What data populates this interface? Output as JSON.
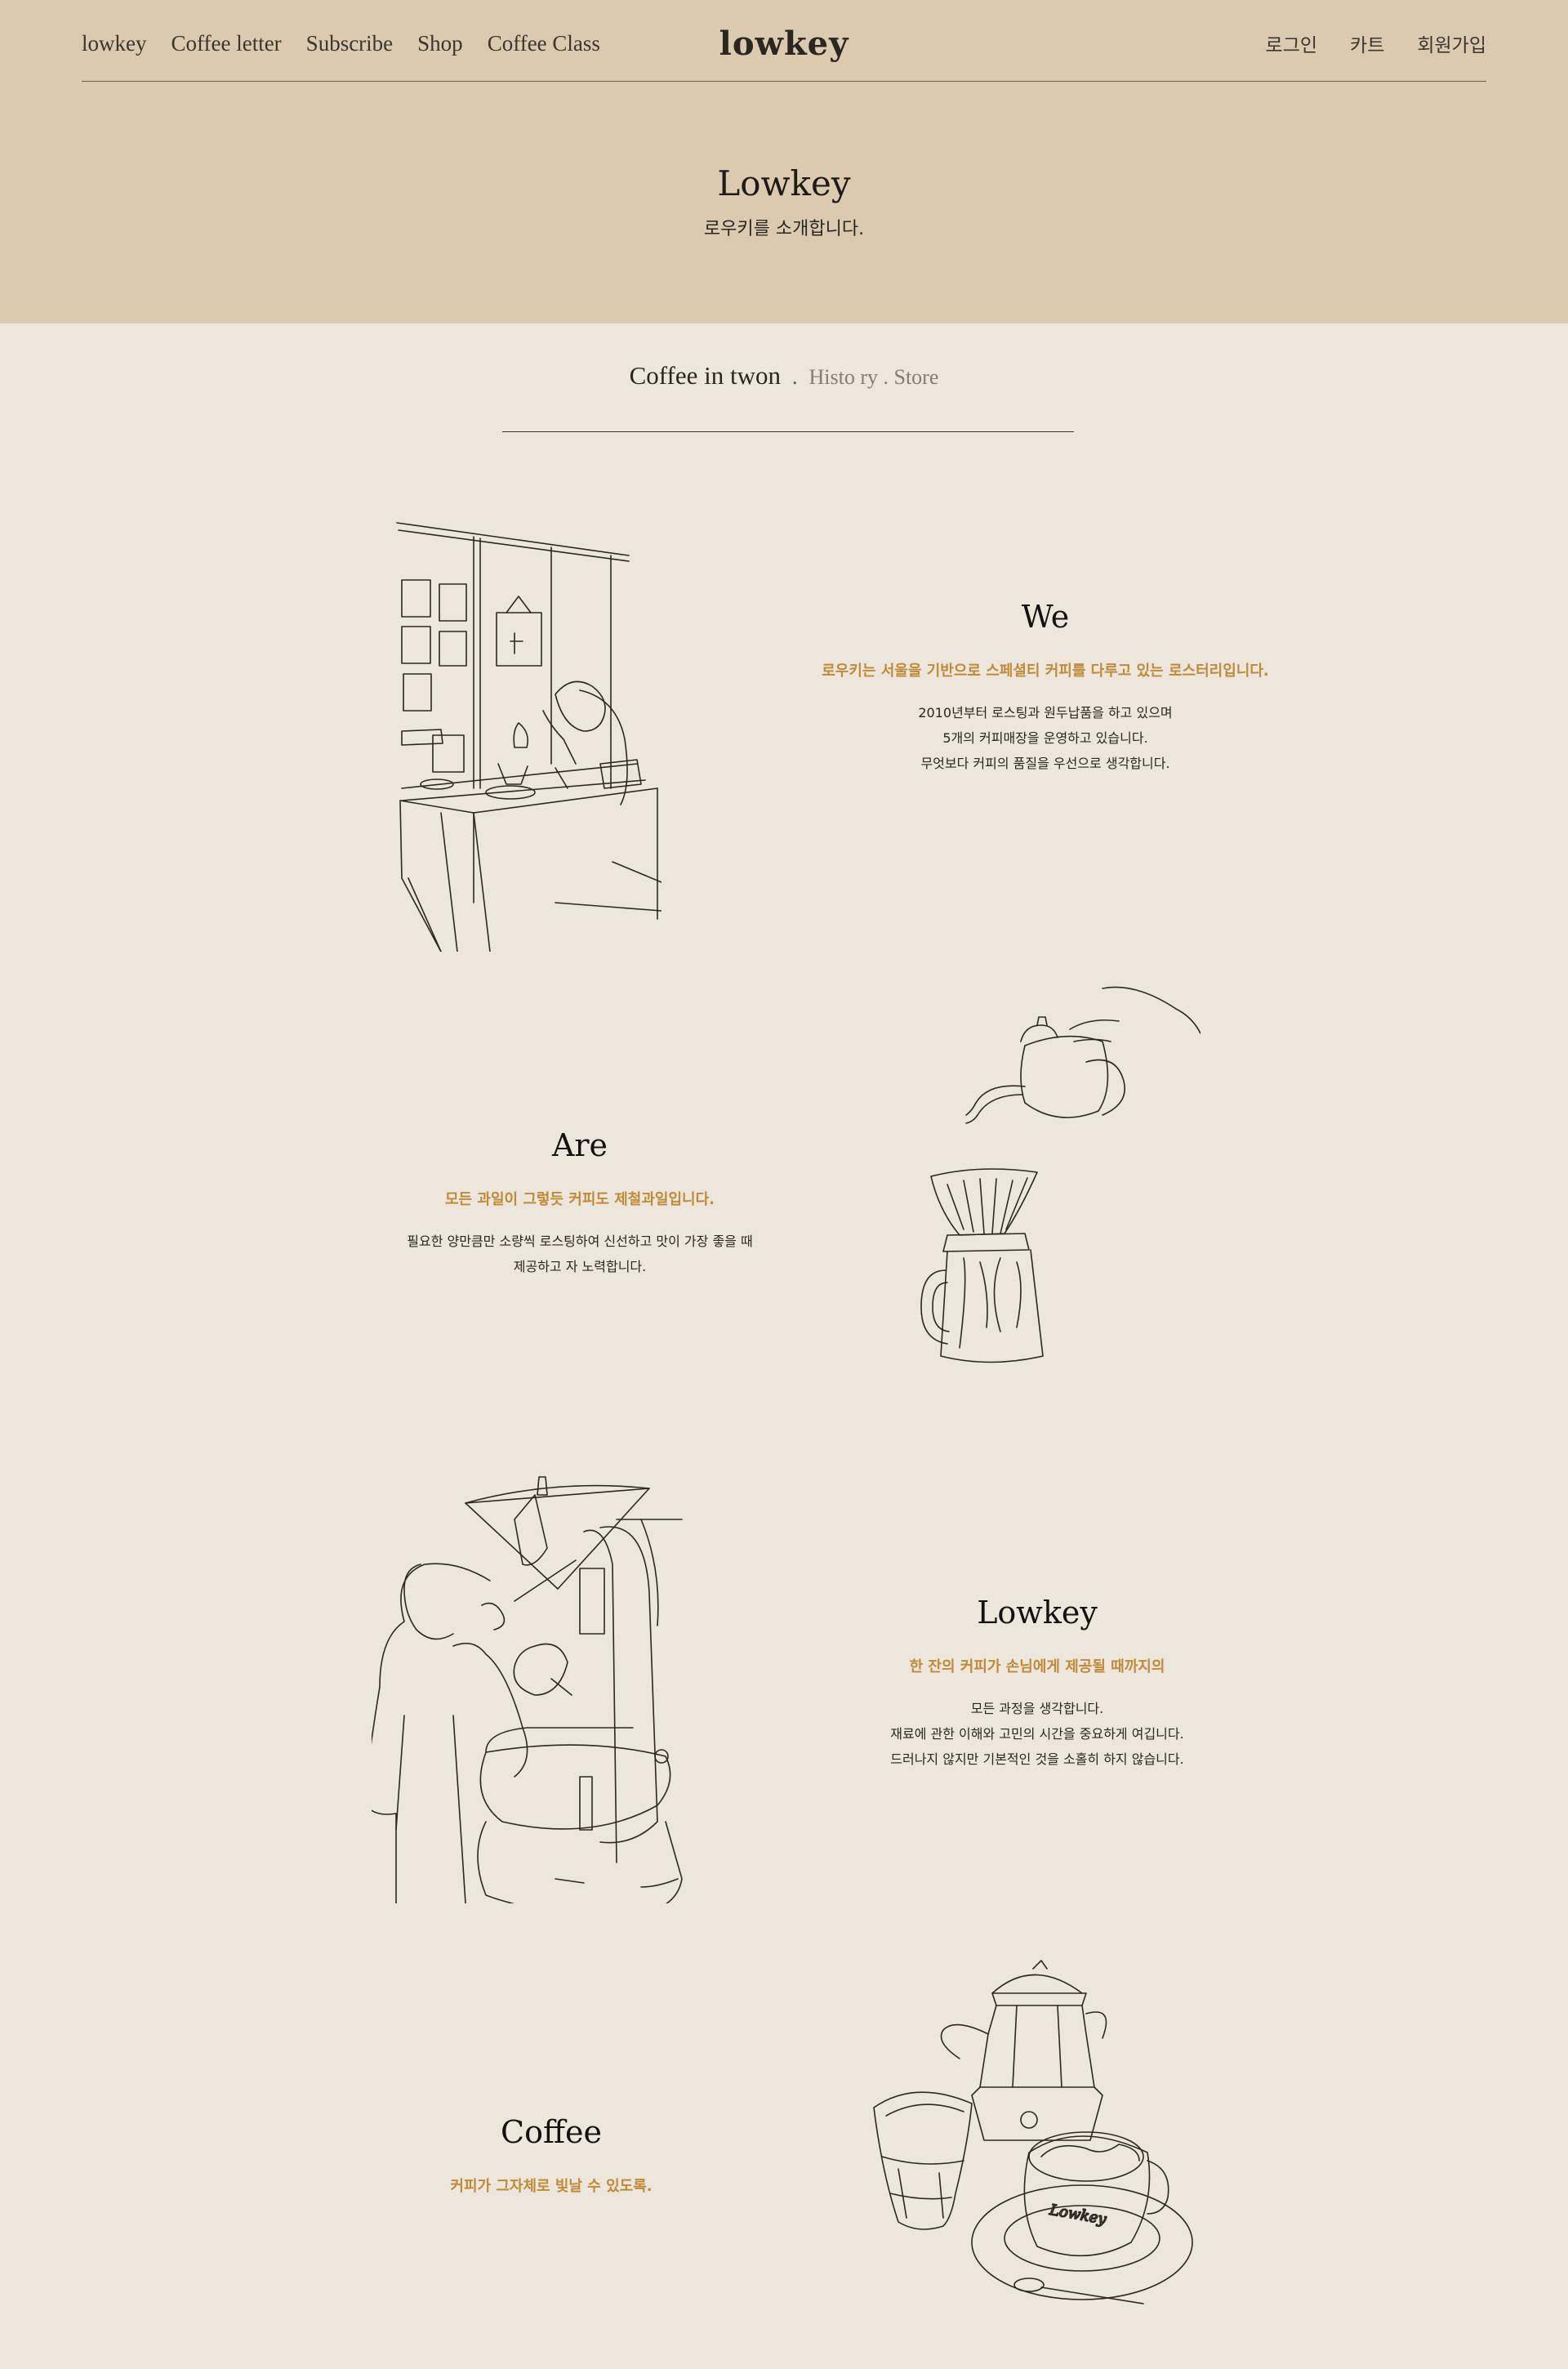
{
  "nav": {
    "left": [
      "lowkey",
      "Coffee letter",
      "Subscribe",
      "Shop",
      "Coffee Class"
    ],
    "brand": "lowkey",
    "right": [
      "로그인",
      "카트",
      "회원가입"
    ]
  },
  "hero": {
    "title": "Lowkey",
    "subtitle": "로우키를 소개합니다."
  },
  "subnav": {
    "main": "Coffee in twon",
    "sep": ".",
    "alt": "Histo ry . Store"
  },
  "sections": [
    {
      "title": "We",
      "lead": "로우키는 서울을 기반으로 스페셜티 커피를 다루고 있는 로스터리입니다.",
      "body": [
        "2010년부터 로스팅과 원두납품을 하고 있으며",
        "5개의 커피매장을 운영하고 있습니다.",
        "무엇보다 커피의 품질을 우선으로 생각합니다."
      ],
      "illustration": "cafe-counter-illustration"
    },
    {
      "title": "Are",
      "lead": "모든 과일이 그렇듯 커피도 제철과일입니다.",
      "body": [
        "필요한 양만큼만 소량씩 로스팅하여 신선하고 맛이 가장 좋을 때",
        "제공하고 자 노력합니다."
      ],
      "illustration": "pour-over-illustration"
    },
    {
      "title": "Lowkey",
      "lead": "한 잔의 커피가 손님에게 제공될 때까지의",
      "body": [
        "모든 과정을 생각합니다.",
        "재료에 관한 이해와 고민의 시간을 중요하게 여깁니다.",
        "드러나지 않지만 기본적인 것을 소홀히 하지 않습니다."
      ],
      "illustration": "roaster-illustration"
    },
    {
      "title": "Coffee",
      "lead": "커피가 그자체로 빛날 수 있도록.",
      "body": [],
      "illustration": "moka-pot-cups-illustration"
    }
  ],
  "cup_text": "Lowkey",
  "colors": {
    "hero_bg": "#dccab0",
    "page_bg": "#ede6dc",
    "accent": "#c08a38",
    "ink": "#2b2822"
  }
}
